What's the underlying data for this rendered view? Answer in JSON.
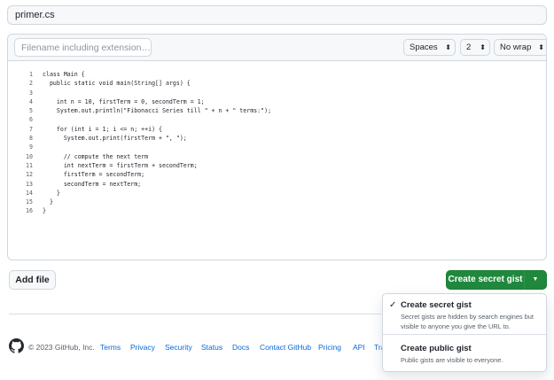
{
  "gist_description": "primer.cs",
  "editor": {
    "filename_placeholder": "Filename including extension…",
    "indent_mode": "Spaces",
    "indent_size": "2",
    "wrap_mode": "No wrap",
    "code_lines": [
      {
        "num": "1",
        "text": "class Main {"
      },
      {
        "num": "2",
        "text": "  public static void main(String[] args) {"
      },
      {
        "num": "3",
        "text": ""
      },
      {
        "num": "4",
        "text": "    int n = 10, firstTerm = 0, secondTerm = 1;"
      },
      {
        "num": "5",
        "text": "    System.out.println(\"Fibonacci Series till \" + n + \" terms:\");"
      },
      {
        "num": "6",
        "text": ""
      },
      {
        "num": "7",
        "text": "    for (int i = 1; i <= n; ++i) {"
      },
      {
        "num": "8",
        "text": "      System.out.print(firstTerm + \", \");"
      },
      {
        "num": "9",
        "text": ""
      },
      {
        "num": "10",
        "text": "      // compute the next term"
      },
      {
        "num": "11",
        "text": "      int nextTerm = firstTerm + secondTerm;"
      },
      {
        "num": "12",
        "text": "      firstTerm = secondTerm;"
      },
      {
        "num": "13",
        "text": "      secondTerm = nextTerm;"
      },
      {
        "num": "14",
        "text": "    }"
      },
      {
        "num": "15",
        "text": "  }"
      },
      {
        "num": "16",
        "text": "}"
      }
    ]
  },
  "actions": {
    "add_file": "Add file",
    "create_secret": "Create secret gist"
  },
  "dropdown": {
    "secret_title": "Create secret gist",
    "secret_desc": "Secret gists are hidden by search engines but visible to anyone you give the URL to.",
    "public_title": "Create public gist",
    "public_desc": "Public gists are visible to everyone."
  },
  "footer": {
    "copyright": "© 2023 GitHub, Inc.",
    "links": [
      "Terms",
      "Privacy",
      "Security",
      "Status",
      "Docs",
      "Contact GitHub",
      "Pricing",
      "API",
      "Tra"
    ]
  },
  "colors": {
    "primary_green": "#1f883d",
    "link_blue": "#0969da",
    "border": "#d0d7de"
  }
}
